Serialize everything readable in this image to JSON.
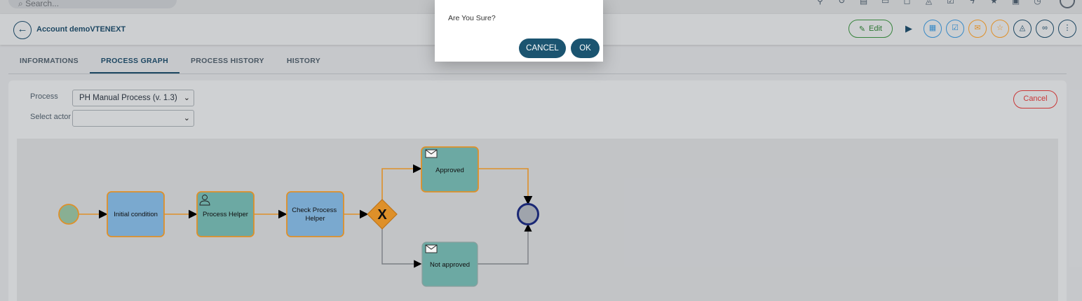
{
  "topbar": {
    "search_placeholder": "Search...",
    "icons": [
      "pin-icon",
      "history-icon",
      "doc-icon",
      "calendar-icon",
      "chat-icon",
      "bell-icon",
      "check-icon",
      "bolt-icon",
      "star-icon",
      "print-icon",
      "clock-icon",
      "user-icon"
    ]
  },
  "header": {
    "back_icon": "arrow-left-icon",
    "title": "Account demoVTENEXT",
    "edit_label": "Edit"
  },
  "tabs": [
    {
      "label": "INFORMATIONS",
      "active": false
    },
    {
      "label": "PROCESS GRAPH",
      "active": true
    },
    {
      "label": "PROCESS HISTORY",
      "active": false
    },
    {
      "label": "HISTORY",
      "active": false
    }
  ],
  "panel": {
    "process_label": "Process",
    "process_value": "PH Manual Process (v. 1.3)",
    "actor_label": "Select actor",
    "actor_value": "",
    "cancel_label": "Cancel"
  },
  "graph": {
    "nodes": {
      "initial": "Initial condition",
      "helper": "Process Helper",
      "check": "Check Process Helper",
      "approved": "Approved",
      "not_approved": "Not approved",
      "gateway": "X"
    }
  },
  "modal": {
    "message": "Are You Sure?",
    "cancel_label": "CANCEL",
    "ok_label": "OK"
  },
  "colors": {
    "accent": "#1b5470",
    "edit_green": "#2d7a33",
    "cancel_red": "#d23a3a",
    "flow_orange": "#e8962b",
    "task_blue": "#7fb0d8",
    "task_teal": "#71b0aa"
  }
}
